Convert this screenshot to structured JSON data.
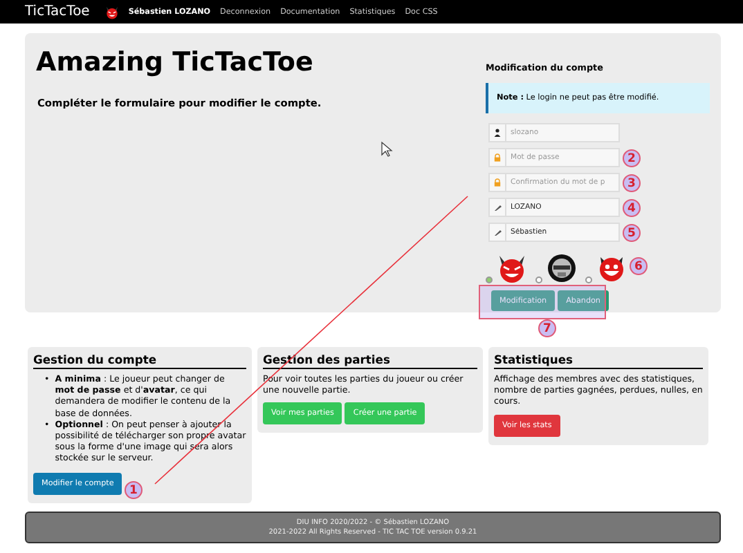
{
  "navbar": {
    "brand": "TicTacToe",
    "user": "Sébastien LOZANO",
    "links": [
      "Deconnexion",
      "Documentation",
      "Statistiques",
      "Doc CSS"
    ]
  },
  "hero": {
    "title": "Amazing TicTacToe",
    "subtitle": "Compléter le formulaire pour modifier le compte."
  },
  "form": {
    "heading": "Modification du compte",
    "note": "**Note :** Le login ne peut pas être modifié.",
    "fields": [
      {
        "kind": "user",
        "placeholder": "slozano"
      },
      {
        "kind": "lock",
        "placeholder": "Mot de passe"
      },
      {
        "kind": "lock",
        "placeholder": "Confirmation du mot de p"
      },
      {
        "kind": "pen",
        "value": "LOZANO"
      },
      {
        "kind": "pen",
        "value": "Sébastien"
      }
    ],
    "avatars": [
      {
        "kind": "devil",
        "selected": true
      },
      {
        "kind": "robot",
        "selected": false
      },
      {
        "kind": "grin",
        "selected": false
      }
    ],
    "buttons": [
      "Modification",
      "Abandon"
    ]
  },
  "cards": [
    {
      "title": "Gestion du compte",
      "items": [
        {
          "marker": "•",
          "text": "**A minima** : Le joueur peut changer de **mot de passe** et d'**avatar**, ce qui demandera de modifier le contenu de la base de données."
        },
        {
          "marker": "•",
          "text": "**Optionnel** : On peut penser à ajouter la possibilité de télécharger son propre avatar sous la forme d'une image qui sera alors stockée sur le serveur."
        }
      ],
      "buttons": [
        {
          "label": "Modifier le compte",
          "color": "#0f7bb0"
        }
      ]
    },
    {
      "title": "Gestion des parties",
      "text": "Pour voir toutes les parties du joueur ou créer une nouvelle partie.",
      "buttons": [
        {
          "label": "Voir mes parties",
          "color": "#34c759"
        },
        {
          "label": "Créer une partie",
          "color": "#34c759"
        }
      ]
    },
    {
      "title": "Statistiques",
      "text": "Affichage des membres avec des statistiques, nombre de parties gagnées, perdues, nulles, en cours.",
      "buttons": [
        {
          "label": "Voir les stats",
          "color": "#e0363d"
        }
      ]
    }
  ],
  "footer": [
    "DIU INFO 2020/2022 - © Sébastien LOZANO",
    "2021-2022 All Rights Reserved - TIC TAC TOE version 0.9.21"
  ],
  "annotations": [
    "1",
    "2",
    "3",
    "4",
    "5",
    "6",
    "7"
  ]
}
